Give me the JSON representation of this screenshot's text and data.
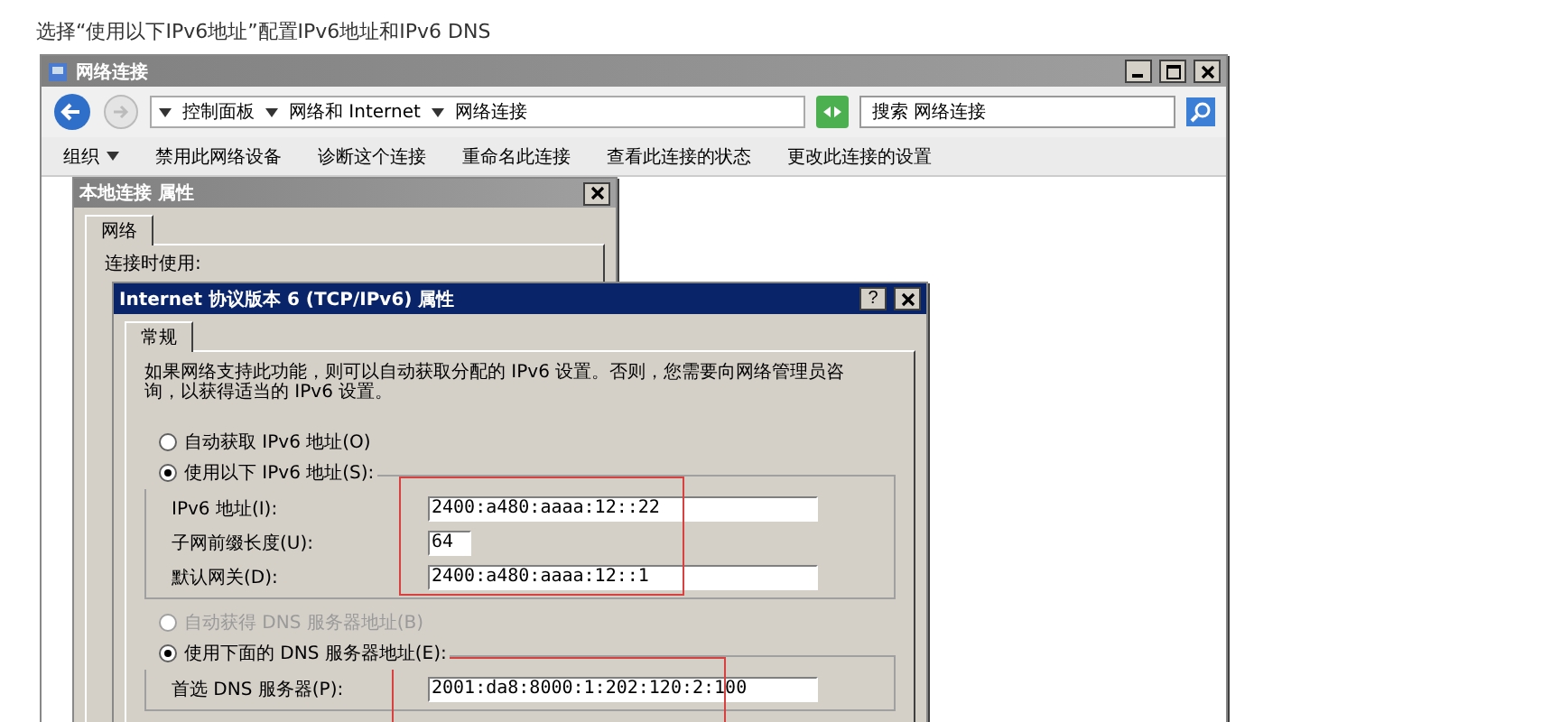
{
  "caption": "选择“使用以下IPv6地址”配置IPv6地址和IPv6 DNS",
  "explorer": {
    "title": "网络连接",
    "breadcrumb": [
      "控制面板",
      "网络和 Internet",
      "网络连接"
    ],
    "search": {
      "placeholder": "搜索 网络连接"
    },
    "toolbar": [
      {
        "label": "组织",
        "kind": "menu"
      },
      {
        "label": "禁用此网络设备",
        "kind": "command"
      },
      {
        "label": "诊断这个连接",
        "kind": "command"
      },
      {
        "label": "重命名此连接",
        "kind": "command"
      },
      {
        "label": "查看此连接的状态",
        "kind": "command"
      },
      {
        "label": "更改此连接的设置",
        "kind": "command"
      }
    ]
  },
  "properties_dialog": {
    "title": "本地连接 属性",
    "tabs": [
      {
        "label": "网络",
        "selected": true
      }
    ],
    "label": "连接时使用:"
  },
  "ipv6_dialog": {
    "title": "Internet 协议版本 6 (TCP/IPv6) 属性",
    "help_label": "?",
    "tabs": [
      {
        "label": "常规",
        "selected": true
      }
    ],
    "description": "如果网络支持此功能，则可以自动获取分配的 IPv6 设置。否则，您需要向网络管理员咨询，以获得适当的 IPv6 设置。",
    "address_options": [
      {
        "label": "自动获取 IPv6 地址(O)",
        "selected": false,
        "disabled": false
      },
      {
        "label": "使用以下 IPv6 地址(S):",
        "selected": true,
        "disabled": false
      }
    ],
    "address_fields": [
      {
        "label": "IPv6 地址(I):",
        "value": "2400:a480:aaaa:12::22",
        "kind": "address"
      },
      {
        "label": "子网前缀长度(U):",
        "value": "64",
        "kind": "prefix"
      },
      {
        "label": "默认网关(D):",
        "value": "2400:a480:aaaa:12::1",
        "kind": "address"
      }
    ],
    "dns_options": [
      {
        "label": "自动获得 DNS 服务器地址(B)",
        "selected": false,
        "disabled": true
      },
      {
        "label": "使用下面的 DNS 服务器地址(E):",
        "selected": true,
        "disabled": false
      }
    ],
    "dns_fields": [
      {
        "label": "首选 DNS 服务器(P):",
        "value": "2001:da8:8000:1:202:120:2:100",
        "kind": "address"
      }
    ]
  }
}
